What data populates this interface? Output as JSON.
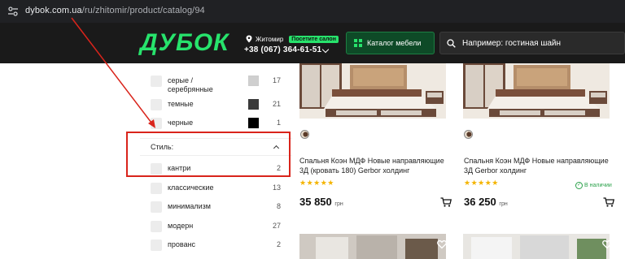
{
  "browser": {
    "url_domain": "dybok.com.ua",
    "url_path": "/ru/zhitomir/product/catalog/94"
  },
  "header": {
    "logo": "ДУБОК",
    "city": "Житомир",
    "visit_badge": "Посетите салон",
    "phone": "+38 (067) 364-61-51",
    "catalog_button": "Каталог мебели",
    "search_placeholder": "Например: гостиная шайн"
  },
  "filters": {
    "color_items": [
      {
        "label": "серые / серебрянные",
        "count": "17",
        "swatch": "#cfcfcf"
      },
      {
        "label": "темные",
        "count": "21",
        "swatch": "#3a3a3a"
      },
      {
        "label": "черные",
        "count": "1",
        "swatch": "#000000"
      }
    ],
    "style_heading": "Стиль:",
    "style_items": [
      {
        "label": "кантри",
        "count": "2"
      },
      {
        "label": "классические",
        "count": "13"
      },
      {
        "label": "минимализм",
        "count": "8"
      },
      {
        "label": "модерн",
        "count": "27"
      },
      {
        "label": "прованс",
        "count": "2"
      }
    ]
  },
  "products": [
    {
      "title": "Спальня Коэн МДФ Новые направляющие 3Д (кровать 180) Gerbor холдинг",
      "price": "35 850",
      "currency": "грн",
      "rating_stars": 5
    },
    {
      "title": "Спальня Коэн МДФ Новые направляющие 3Д Gerbor холдинг",
      "price": "36 250",
      "currency": "грн",
      "rating_stars": 5,
      "stock": "В наличии"
    }
  ],
  "colors": {
    "header_bg": "#1a1a1a",
    "brand_green": "#27e36c",
    "annotation_red": "#d9241b",
    "star": "#f4b400"
  }
}
